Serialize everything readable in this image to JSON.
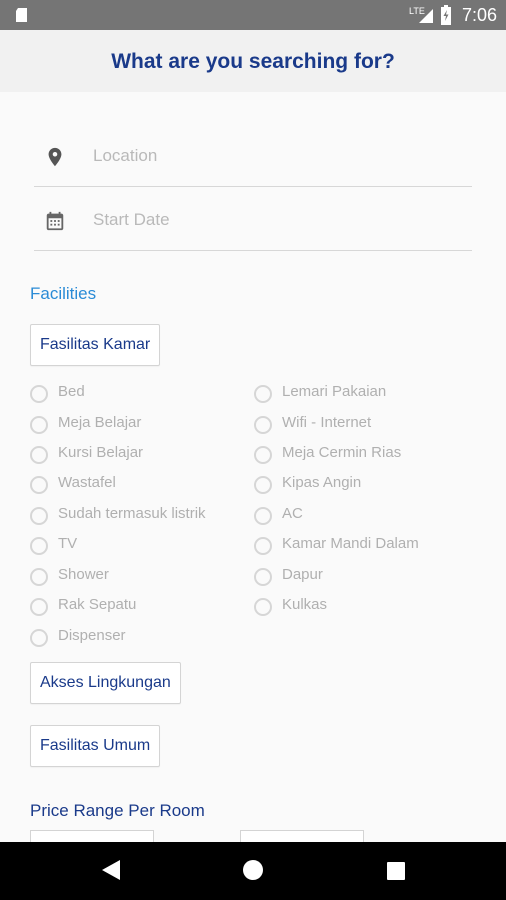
{
  "status_bar": {
    "time": "7:06",
    "network": "LTE"
  },
  "header": {
    "title": "What are you searching for?"
  },
  "form": {
    "location_placeholder": "Location",
    "start_date_placeholder": "Start Date"
  },
  "facilities": {
    "label": "Facilities",
    "fasilitas_kamar_label": "Fasilitas Kamar",
    "left_items": [
      "Bed",
      "Meja Belajar",
      "Kursi Belajar",
      "Wastafel",
      "Sudah termasuk listrik",
      "TV",
      "Shower",
      "Rak Sepatu",
      "Dispenser"
    ],
    "right_items": [
      "Lemari Pakaian",
      "Wifi - Internet",
      "Meja Cermin Rias",
      "Kipas Angin",
      "AC",
      "Kamar Mandi Dalam",
      "Dapur",
      "Kulkas"
    ],
    "akses_lingkungan_label": "Akses Lingkungan",
    "fasilitas_umum_label": "Fasilitas Umum"
  },
  "price": {
    "label": "Price Range Per Room"
  },
  "colors": {
    "primary": "#1a3a8a",
    "link": "#2a8bd6",
    "statusbar": "#757575",
    "navbar": "#000000"
  },
  "icons": {
    "location": "location-pin-icon",
    "date": "calendar-icon",
    "back": "back-icon",
    "home": "home-icon",
    "recents": "recents-icon"
  }
}
